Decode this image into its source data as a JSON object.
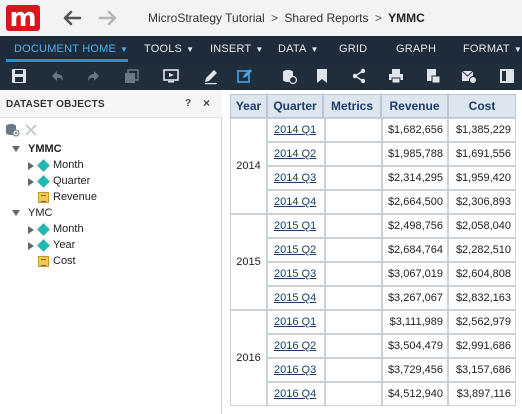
{
  "app": {
    "logo_letter": "m",
    "brand_color": "#d7161e"
  },
  "breadcrumb": {
    "items": [
      "MicroStrategy Tutorial",
      "Shared Reports"
    ],
    "separator": ">",
    "current": "YMMC"
  },
  "menu": {
    "items": [
      {
        "label": "DOCUMENT HOME",
        "active": true
      },
      {
        "label": "TOOLS"
      },
      {
        "label": "INSERT"
      },
      {
        "label": "DATA"
      },
      {
        "label": "GRID"
      },
      {
        "label": "GRAPH"
      },
      {
        "label": "FORMAT"
      }
    ],
    "accent": "#4fb0f0"
  },
  "toolbar": {
    "icons": [
      "save-icon",
      "undo-icon",
      "redo-icon",
      "refresh-icon",
      "present-icon",
      "edit-icon",
      "design-icon",
      "insert-data-icon",
      "bookmark-icon",
      "share-icon",
      "print-icon",
      "export-icon",
      "subscribe-icon",
      "view-icon"
    ]
  },
  "dataset_panel": {
    "title": "DATASET OBJECTS",
    "help": "?",
    "close": "×",
    "datasets": [
      {
        "name": "YMMC",
        "objects": [
          {
            "label": "Month",
            "type": "attribute",
            "expandable": true
          },
          {
            "label": "Quarter",
            "type": "attribute",
            "expandable": true
          },
          {
            "label": "Revenue",
            "type": "metric",
            "expandable": false
          }
        ]
      },
      {
        "name": "YMC",
        "objects": [
          {
            "label": "Month",
            "type": "attribute",
            "expandable": true
          },
          {
            "label": "Year",
            "type": "attribute",
            "expandable": true
          },
          {
            "label": "Cost",
            "type": "metric",
            "expandable": false
          }
        ]
      }
    ]
  },
  "grid": {
    "headers": [
      "Year",
      "Quarter",
      "Metrics",
      "Revenue",
      "Cost"
    ],
    "groups": [
      {
        "year": "2014",
        "rows": [
          {
            "quarter": "2014 Q1",
            "revenue": "$1,682,656",
            "cost": "$1,385,229"
          },
          {
            "quarter": "2014 Q2",
            "revenue": "$1,985,788",
            "cost": "$1,691,556"
          },
          {
            "quarter": "2014 Q3",
            "revenue": "$2,314,295",
            "cost": "$1,959,420"
          },
          {
            "quarter": "2014 Q4",
            "revenue": "$2,664,500",
            "cost": "$2,306,893"
          }
        ]
      },
      {
        "year": "2015",
        "rows": [
          {
            "quarter": "2015 Q1",
            "revenue": "$2,498,756",
            "cost": "$2,058,040"
          },
          {
            "quarter": "2015 Q2",
            "revenue": "$2,684,764",
            "cost": "$2,282,510"
          },
          {
            "quarter": "2015 Q3",
            "revenue": "$3,067,019",
            "cost": "$2,604,808"
          },
          {
            "quarter": "2015 Q4",
            "revenue": "$3,267,067",
            "cost": "$2,832,163"
          }
        ]
      },
      {
        "year": "2016",
        "rows": [
          {
            "quarter": "2016 Q1",
            "revenue": "$3,111,989",
            "cost": "$2,562,979"
          },
          {
            "quarter": "2016 Q2",
            "revenue": "$3,504,479",
            "cost": "$2,991,686"
          },
          {
            "quarter": "2016 Q3",
            "revenue": "$3,729,456",
            "cost": "$3,157,686"
          },
          {
            "quarter": "2016 Q4",
            "revenue": "$4,512,940",
            "cost": "$3,897,116"
          }
        ]
      }
    ]
  }
}
